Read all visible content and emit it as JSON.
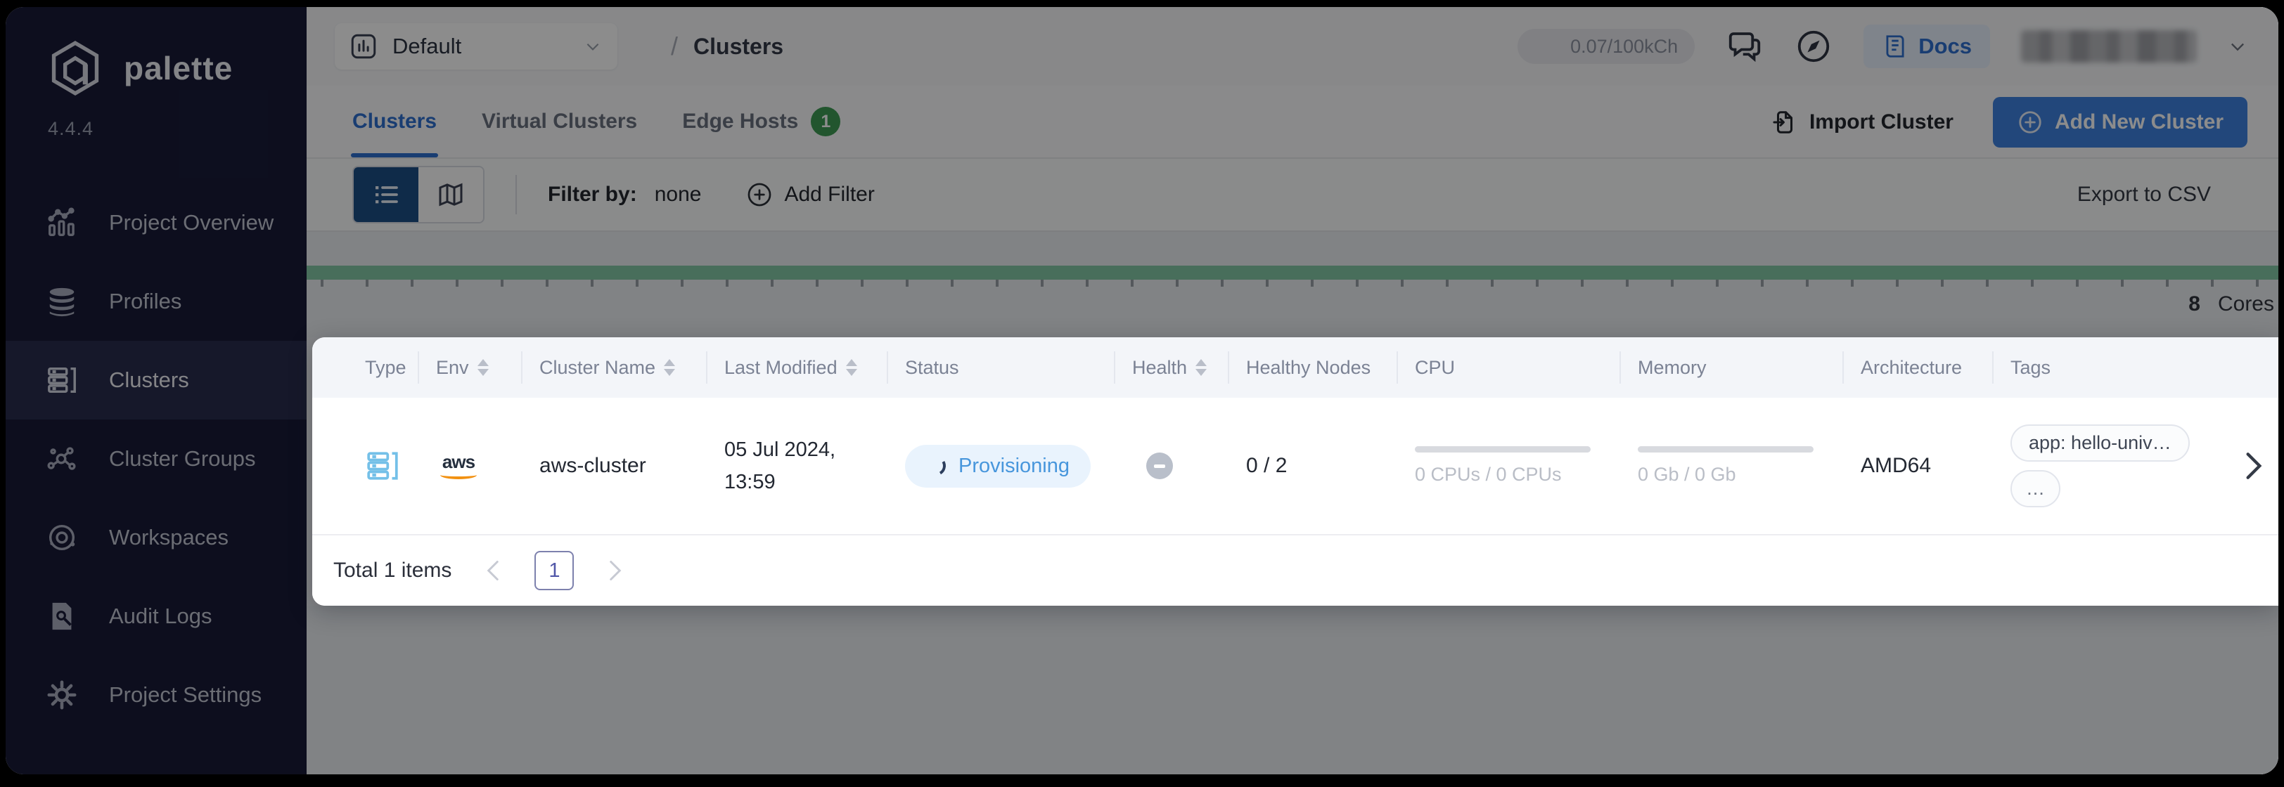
{
  "app": {
    "name": "palette",
    "version": "4.4.4"
  },
  "sidebar": {
    "items": [
      {
        "label": "Project Overview",
        "active": false
      },
      {
        "label": "Profiles",
        "active": false
      },
      {
        "label": "Clusters",
        "active": true
      },
      {
        "label": "Cluster Groups",
        "active": false
      },
      {
        "label": "Workspaces",
        "active": false
      },
      {
        "label": "Audit Logs",
        "active": false
      },
      {
        "label": "Project Settings",
        "active": false
      }
    ]
  },
  "topbar": {
    "project_selector_value": "Default",
    "breadcrumb_separator": "/",
    "breadcrumb_current": "Clusters",
    "usage": "0.07/100kCh",
    "docs_label": "Docs"
  },
  "tabs": {
    "items": [
      {
        "label": "Clusters",
        "active": true
      },
      {
        "label": "Virtual Clusters",
        "active": false
      },
      {
        "label": "Edge Hosts",
        "active": false,
        "badge": "1"
      }
    ]
  },
  "header_actions": {
    "import_label": "Import Cluster",
    "add_label": "Add New Cluster"
  },
  "filter_bar": {
    "filter_by_label": "Filter by:",
    "filter_by_value": "none",
    "add_filter_label": "Add Filter",
    "export_label": "Export to CSV"
  },
  "capacity": {
    "cores_value": "8",
    "cores_unit": "Cores",
    "bar_color": "#83c9a6"
  },
  "table": {
    "columns": [
      {
        "label": "Type",
        "sortable": false
      },
      {
        "label": "Env",
        "sortable": true
      },
      {
        "label": "Cluster Name",
        "sortable": true
      },
      {
        "label": "Last Modified",
        "sortable": true
      },
      {
        "label": "Status",
        "sortable": false
      },
      {
        "label": "Health",
        "sortable": true
      },
      {
        "label": "Healthy Nodes",
        "sortable": false
      },
      {
        "label": "CPU",
        "sortable": false
      },
      {
        "label": "Memory",
        "sortable": false
      },
      {
        "label": "Architecture",
        "sortable": false
      },
      {
        "label": "Tags",
        "sortable": false
      }
    ],
    "row": {
      "env": "aws",
      "name": "aws-cluster",
      "modified_date": "05 Jul 2024,",
      "modified_time": "13:59",
      "status": "Provisioning",
      "status_color": "#4796dc",
      "health": "unknown",
      "healthy_nodes": "0 / 2",
      "cpu": "0 CPUs / 0 CPUs",
      "memory": "0 Gb / 0 Gb",
      "architecture": "AMD64",
      "tag_primary": "app: hello-univ…",
      "tag_more": "…"
    },
    "footer": {
      "total_label": "Total 1 items",
      "page": "1"
    }
  },
  "colors": {
    "accent_blue": "#2f6fd0",
    "button_blue": "#3e82e0",
    "sidebar_bg": "#181b38",
    "badge_green": "#3f9b55",
    "usage_green": "#83c9a6",
    "status_pill_bg": "#e9f3fd"
  }
}
